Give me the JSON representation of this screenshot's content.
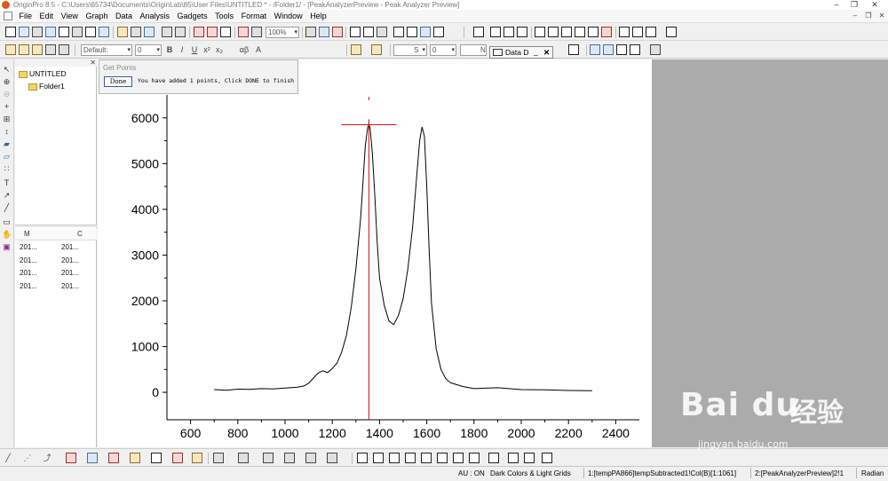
{
  "window": {
    "title": "OriginPro 8.5 - C:\\Users\\65734\\Documents\\OriginLab\\85\\User Files\\UNTITLED * - /Folder1/ - [PeakAnalyzerPreview - Peak Analyzer Preview]",
    "min_glyph": "–",
    "restore_glyph": "❐",
    "close_glyph": "✕"
  },
  "menu": [
    "File",
    "Edit",
    "View",
    "Graph",
    "Data",
    "Analysis",
    "Gadgets",
    "Tools",
    "Format",
    "Window",
    "Help"
  ],
  "toolbar": {
    "zoom_value": "100%",
    "font_value": "Default:",
    "size_value": "0",
    "bold_label": "B",
    "italic_label": "I",
    "underline_label": "U",
    "sup_label": "x²",
    "sub_label": "x₂",
    "greek_label": "αβ",
    "grow_label": "A",
    "line_style_value": "S",
    "line_width_value": "0",
    "fill_value": "N"
  },
  "project_explorer": {
    "root": "UNTITLED",
    "folder": "Folder1",
    "columns": [
      "M",
      "C"
    ],
    "rows": [
      [
        "201...",
        "201..."
      ],
      [
        "201...",
        "201..."
      ],
      [
        "201...",
        "201..."
      ],
      [
        "201...",
        "201..."
      ]
    ]
  },
  "get_points": {
    "title": "Get Points",
    "done_label": "Done",
    "message": "You have added 1 points, Click DONE to finish"
  },
  "data_popup": {
    "label": "Data D",
    "minimize": "_",
    "close": "✕"
  },
  "chart_data": {
    "type": "line",
    "xlim": [
      500,
      2500
    ],
    "ylim": [
      -600,
      6500
    ],
    "x_ticks": [
      600,
      800,
      1000,
      1200,
      1400,
      1600,
      1800,
      2000,
      2200,
      2400
    ],
    "y_ticks": [
      0,
      1000,
      2000,
      3000,
      4000,
      5000,
      6000
    ],
    "grid": false,
    "series": [
      {
        "color": "#000000",
        "x": [
          700,
          750,
          800,
          850,
          900,
          950,
          1000,
          1050,
          1080,
          1100,
          1120,
          1140,
          1160,
          1180,
          1200,
          1220,
          1240,
          1260,
          1280,
          1300,
          1320,
          1330,
          1340,
          1350,
          1355,
          1360,
          1370,
          1380,
          1390,
          1400,
          1420,
          1440,
          1460,
          1480,
          1500,
          1520,
          1540,
          1560,
          1570,
          1580,
          1590,
          1600,
          1610,
          1620,
          1640,
          1660,
          1680,
          1700,
          1750,
          1800,
          1900,
          2000,
          2100,
          2200,
          2300
        ],
        "y": [
          60,
          45,
          70,
          65,
          80,
          75,
          95,
          110,
          140,
          200,
          310,
          420,
          470,
          430,
          520,
          640,
          880,
          1250,
          1850,
          2700,
          3800,
          4600,
          5400,
          5790,
          5850,
          5780,
          5200,
          4300,
          3300,
          2500,
          1900,
          1560,
          1480,
          1680,
          2050,
          2700,
          3600,
          4900,
          5500,
          5800,
          5600,
          4500,
          3100,
          1950,
          950,
          500,
          300,
          210,
          130,
          80,
          100,
          60,
          55,
          40,
          35
        ]
      }
    ],
    "marker_line_x": 1355,
    "crosshair_point": [
      1355,
      5850
    ]
  },
  "status": {
    "au": "AU : ON",
    "theme": "Dark Colors & Light Grids",
    "col": "1:[tempPA866]tempSubtracted1!Col(B)[1:1061]",
    "layer": "2:[PeakAnalyzerPreview]2!1",
    "unit": "Radian"
  },
  "watermark": {
    "brand": "Bai du",
    "cn": "经验",
    "url": "jingyan.baidu.com"
  }
}
